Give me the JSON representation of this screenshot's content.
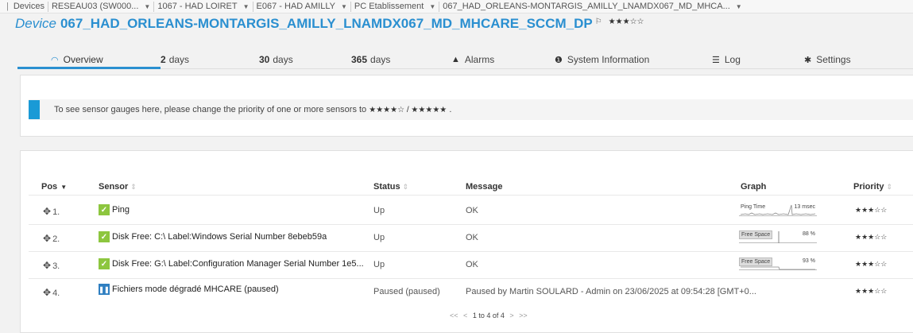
{
  "breadcrumb": {
    "items": [
      "Devices",
      "RESEAU03 (SW000...",
      "1067 - HAD LOIRET",
      "E067 - HAD AMILLY",
      "PC Etablissement",
      "067_HAD_ORLEANS-MONTARGIS_AMILLY_LNAMDX067_MD_MHCA..."
    ]
  },
  "device": {
    "keyword": "Device",
    "name": "067_HAD_ORLEANS-MONTARGIS_AMILLY_LNAMDX067_MD_MHCARE_SCCM_DP",
    "priority_stars": "★★★☆☆"
  },
  "tabs": {
    "overview": "Overview",
    "days2_num": "2",
    "days30_num": "30",
    "days365_num": "365",
    "days_word": "days",
    "alarms": "Alarms",
    "sysinfo": "System Information",
    "log": "Log",
    "settings": "Settings"
  },
  "notice": {
    "text": "To see sensor gauges here, please change the priority of one or more sensors to",
    "stars_a": "★★★★☆",
    "sep": " / ",
    "stars_b": "★★★★★",
    "end": "."
  },
  "table": {
    "headers": {
      "pos": "Pos",
      "sensor": "Sensor",
      "status": "Status",
      "message": "Message",
      "graph": "Graph",
      "priority": "Priority"
    },
    "rows": [
      {
        "pos": "1.",
        "sensor": "Ping",
        "status": "Up",
        "message": "OK",
        "graph_label": "Ping Time",
        "graph_value": "13 msec",
        "priority": "★★★☆☆",
        "state": "up"
      },
      {
        "pos": "2.",
        "sensor": "Disk Free: C:\\ Label:Windows Serial Number 8ebeb59a",
        "status": "Up",
        "message": "OK",
        "graph_label": "Free Space",
        "graph_value": "88 %",
        "priority": "★★★☆☆",
        "state": "up"
      },
      {
        "pos": "3.",
        "sensor": "Disk Free: G:\\ Label:Configuration Manager Serial Number 1e5...",
        "status": "Up",
        "message": "OK",
        "graph_label": "Free Space",
        "graph_value": "93 %",
        "priority": "★★★☆☆",
        "state": "up"
      },
      {
        "pos": "4.",
        "sensor": "Fichiers mode dégradé MHCARE (paused)",
        "status": "Paused (paused)",
        "message": "Paused by Martin SOULARD - Admin on 23/06/2025 at 09:54:28 [GMT+0...",
        "graph_label": "",
        "graph_value": "",
        "priority": "★★★☆☆",
        "state": "paused"
      }
    ],
    "pager": {
      "first": "<<",
      "prev": "<",
      "text": "1 to 4 of 4",
      "next": ">",
      "last": ">>"
    }
  },
  "colors": {
    "accent": "#2a8fd0",
    "up": "#8dc63f",
    "paused": "#2f7fc1",
    "notice_bar": "#1a9ad6"
  }
}
